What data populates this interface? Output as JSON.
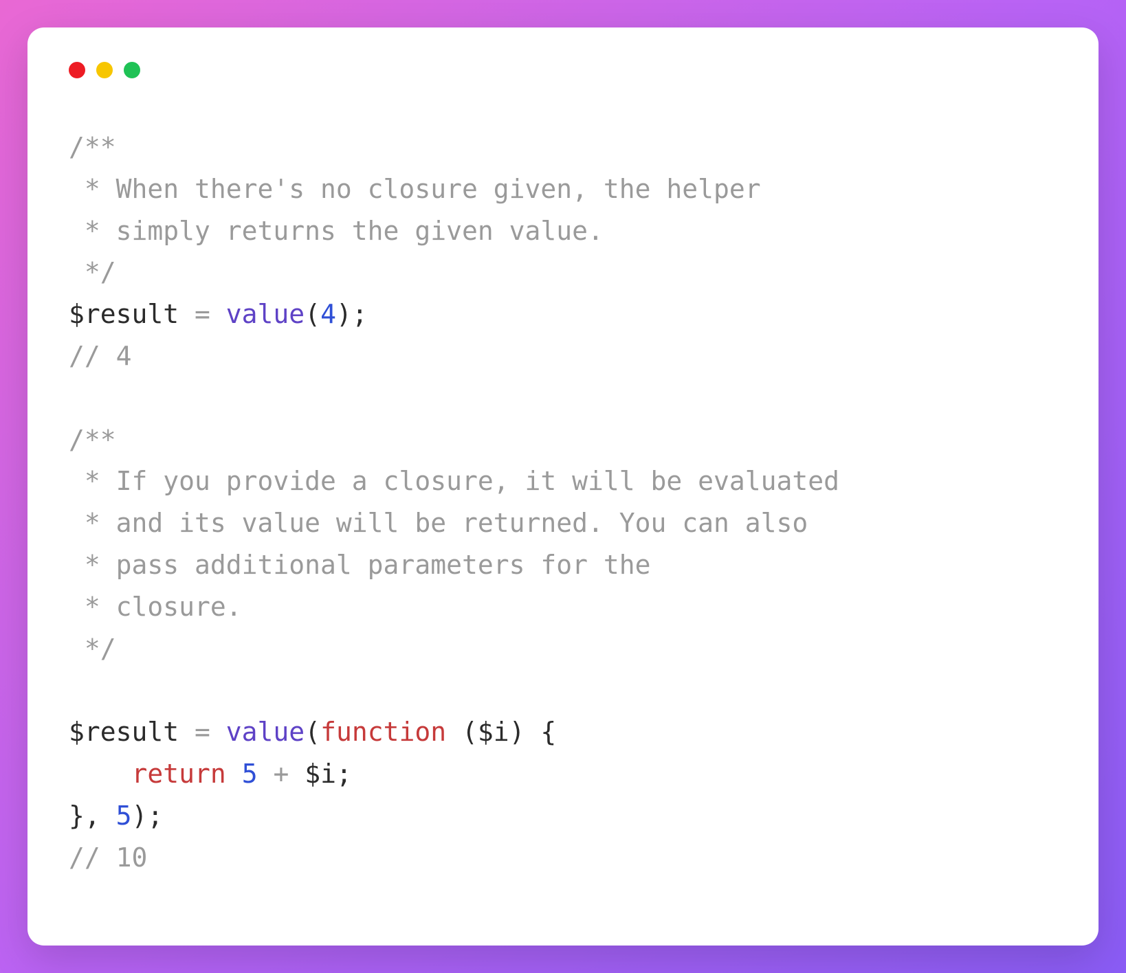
{
  "code": {
    "block1": {
      "c1": "/**",
      "c2": " * When there's no closure given, the helper",
      "c3": " * simply returns the given value.",
      "c4": " */",
      "var1": "$result",
      "assign": " = ",
      "fn1": "value",
      "open1": "(",
      "num1": "4",
      "close1": ");",
      "c5": "// 4"
    },
    "block2": {
      "c1": "/**",
      "c2": " * If you provide a closure, it will be evaluated",
      "c3": " * and its value will be returned. You can also",
      "c4": " * pass additional parameters for the",
      "c5": " * closure.",
      "c6": " */"
    },
    "block3": {
      "var1": "$result",
      "assign": " = ",
      "fn1": "value",
      "open1": "(",
      "kw_function": "function",
      "params": " ($i) {",
      "indent": "    ",
      "kw_return": "return",
      "space": " ",
      "num5": "5",
      "plus": " + ",
      "vari": "$i",
      "semi": ";",
      "close_brace": "}, ",
      "num5b": "5",
      "close2": ");",
      "c_result": "// 10"
    }
  }
}
